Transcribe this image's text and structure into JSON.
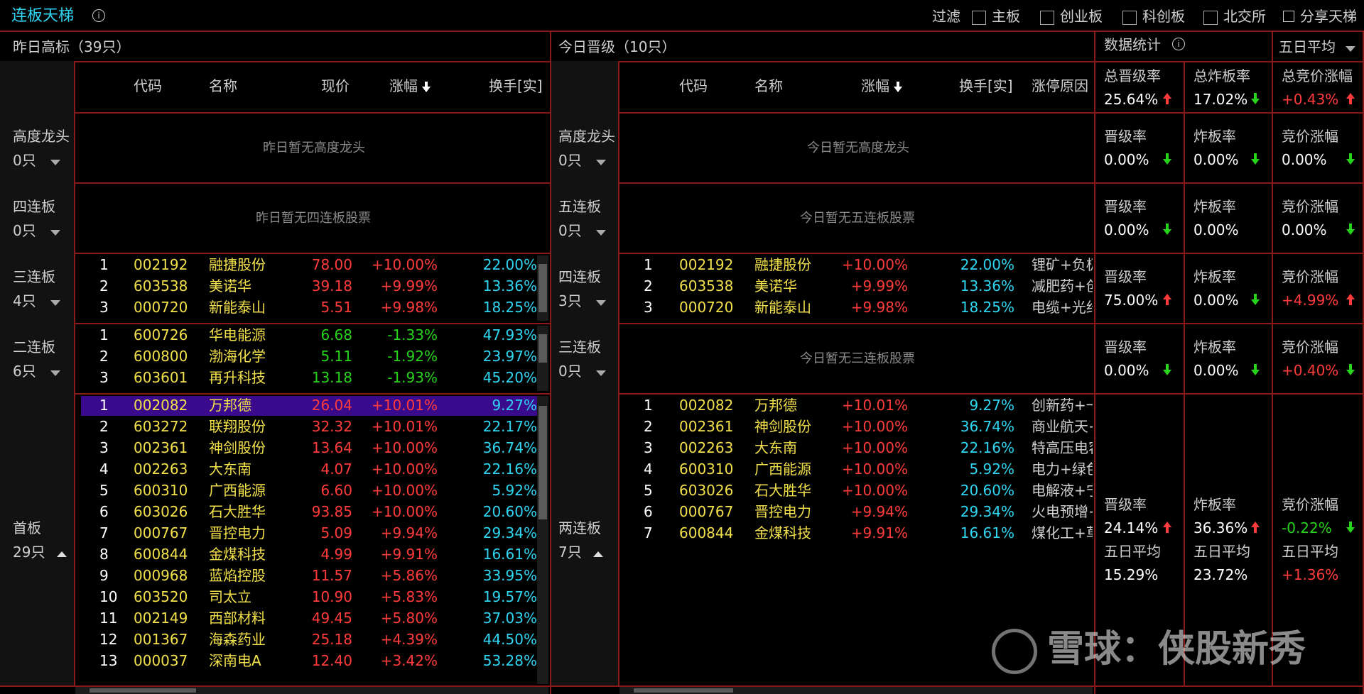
{
  "header": {
    "title": "连板天梯",
    "filter_label": "过滤",
    "filters": [
      "主板",
      "创业板",
      "科创板",
      "北交所"
    ],
    "share_label": "分享天梯"
  },
  "left": {
    "title": "昨日高标（39只）",
    "columns": [
      "代码",
      "名称",
      "现价",
      "涨幅",
      "换手[实]"
    ],
    "groups": [
      {
        "label": "高度龙头",
        "count": "0只",
        "empty": "昨日暂无高度龙头"
      },
      {
        "label": "四连板",
        "count": "0只",
        "empty": "昨日暂无四连板股票"
      },
      {
        "label": "三连板",
        "count": "4只"
      },
      {
        "label": "二连板",
        "count": "6只"
      },
      {
        "label": "首板",
        "count": "29只"
      }
    ],
    "rows_3": [
      [
        "1",
        "002192",
        "融捷股份",
        "78.00",
        "+10.00%",
        "22.00%"
      ],
      [
        "2",
        "603538",
        "美诺华",
        "39.18",
        "+9.99%",
        "13.36%"
      ],
      [
        "3",
        "000720",
        "新能泰山",
        "5.51",
        "+9.98%",
        "18.25%"
      ]
    ],
    "rows_2": [
      [
        "1",
        "600726",
        "华电能源",
        "6.68",
        "-1.33%",
        "47.93%"
      ],
      [
        "2",
        "600800",
        "渤海化学",
        "5.11",
        "-1.92%",
        "23.97%"
      ],
      [
        "3",
        "603601",
        "再升科技",
        "13.18",
        "-1.93%",
        "45.20%"
      ]
    ],
    "rows_1": [
      [
        "1",
        "002082",
        "万邦德",
        "26.04",
        "+10.01%",
        "9.27%"
      ],
      [
        "2",
        "603272",
        "联翔股份",
        "32.32",
        "+10.01%",
        "22.17%"
      ],
      [
        "3",
        "002361",
        "神剑股份",
        "13.64",
        "+10.00%",
        "36.74%"
      ],
      [
        "4",
        "002263",
        "大东南",
        "4.07",
        "+10.00%",
        "22.16%"
      ],
      [
        "5",
        "600310",
        "广西能源",
        "6.60",
        "+10.00%",
        "5.92%"
      ],
      [
        "6",
        "603026",
        "石大胜华",
        "93.85",
        "+10.00%",
        "20.60%"
      ],
      [
        "7",
        "000767",
        "晋控电力",
        "5.09",
        "+9.94%",
        "29.34%"
      ],
      [
        "8",
        "600844",
        "金煤科技",
        "4.99",
        "+9.91%",
        "16.61%"
      ],
      [
        "9",
        "000968",
        "蓝焰控股",
        "11.57",
        "+5.86%",
        "33.95%"
      ],
      [
        "10",
        "603520",
        "司太立",
        "10.90",
        "+5.83%",
        "19.57%"
      ],
      [
        "11",
        "002149",
        "西部材料",
        "49.45",
        "+5.80%",
        "37.03%"
      ],
      [
        "12",
        "001367",
        "海森药业",
        "25.18",
        "+4.39%",
        "44.50%"
      ],
      [
        "13",
        "000037",
        "深南电A",
        "12.40",
        "+3.42%",
        "53.28%"
      ]
    ]
  },
  "middle": {
    "title": "今日晋级（10只）",
    "columns": [
      "代码",
      "名称",
      "涨幅",
      "换手[实]",
      "涨停原因"
    ],
    "groups": [
      {
        "label": "高度龙头",
        "count": "0只",
        "empty": "今日暂无高度龙头"
      },
      {
        "label": "五连板",
        "count": "0只",
        "empty": "今日暂无五连板股票"
      },
      {
        "label": "四连板",
        "count": "3只"
      },
      {
        "label": "三连板",
        "count": "0只",
        "empty": "今日暂无三连板股票"
      },
      {
        "label": "两连板",
        "count": "7只"
      }
    ],
    "rows_4": [
      [
        "1",
        "002192",
        "融捷股份",
        "+10.00%",
        "22.00%",
        "锂矿+负极"
      ],
      [
        "2",
        "603538",
        "美诺华",
        "+9.99%",
        "13.36%",
        "减肥药+创"
      ],
      [
        "3",
        "000720",
        "新能泰山",
        "+9.98%",
        "18.25%",
        "电缆+光纤"
      ]
    ],
    "rows_2": [
      [
        "1",
        "002082",
        "万邦德",
        "+10.01%",
        "9.27%",
        "创新药+一"
      ],
      [
        "2",
        "002361",
        "神剑股份",
        "+10.00%",
        "36.74%",
        "商业航天+"
      ],
      [
        "3",
        "002263",
        "大东南",
        "+10.00%",
        "22.16%",
        "特高压电容"
      ],
      [
        "4",
        "600310",
        "广西能源",
        "+10.00%",
        "5.92%",
        "电力+绿色"
      ],
      [
        "5",
        "603026",
        "石大胜华",
        "+10.00%",
        "20.60%",
        "电解液+宁"
      ],
      [
        "6",
        "000767",
        "晋控电力",
        "+9.94%",
        "29.34%",
        "火电预增+"
      ],
      [
        "7",
        "600844",
        "金煤科技",
        "+9.91%",
        "16.61%",
        "煤化工+草"
      ]
    ]
  },
  "stats": {
    "title": "数据统计",
    "period": "五日平均",
    "totals": [
      {
        "label": "总晋级率",
        "value": "25.64%",
        "dir": "up",
        "color": "white"
      },
      {
        "label": "总炸板率",
        "value": "17.02%",
        "dir": "down",
        "color": "white"
      },
      {
        "label": "总竞价涨幅",
        "value": "+0.43%",
        "dir": "up",
        "color": "red"
      }
    ],
    "rows": [
      [
        {
          "label": "晋级率",
          "value": "0.00%",
          "dir": "down",
          "color": "white"
        },
        {
          "label": "炸板率",
          "value": "0.00%",
          "dir": "down",
          "color": "white"
        },
        {
          "label": "竞价涨幅",
          "value": "0.00%",
          "dir": "down",
          "color": "white"
        }
      ],
      [
        {
          "label": "晋级率",
          "value": "0.00%",
          "dir": "down",
          "color": "white"
        },
        {
          "label": "炸板率",
          "value": "0.00%",
          "dir": "",
          "color": "white"
        },
        {
          "label": "竞价涨幅",
          "value": "0.00%",
          "dir": "down",
          "color": "white"
        }
      ],
      [
        {
          "label": "晋级率",
          "value": "75.00%",
          "dir": "up",
          "color": "white"
        },
        {
          "label": "炸板率",
          "value": "0.00%",
          "dir": "down",
          "color": "white"
        },
        {
          "label": "竞价涨幅",
          "value": "+4.99%",
          "dir": "up",
          "color": "red"
        }
      ],
      [
        {
          "label": "晋级率",
          "value": "0.00%",
          "dir": "down",
          "color": "white"
        },
        {
          "label": "炸板率",
          "value": "0.00%",
          "dir": "down",
          "color": "white"
        },
        {
          "label": "竞价涨幅",
          "value": "+0.40%",
          "dir": "down",
          "color": "red"
        }
      ]
    ],
    "last": [
      {
        "label": "晋级率",
        "value": "24.14%",
        "dir": "up",
        "color": "white",
        "avg_label": "五日平均",
        "avg": "15.29%",
        "avg_color": "white"
      },
      {
        "label": "炸板率",
        "value": "36.36%",
        "dir": "up",
        "color": "white",
        "avg_label": "五日平均",
        "avg": "23.72%",
        "avg_color": "white"
      },
      {
        "label": "竞价涨幅",
        "value": "-0.22%",
        "dir": "down",
        "color": "green",
        "avg_label": "五日平均",
        "avg": "+1.36%",
        "avg_color": "red"
      }
    ]
  },
  "watermark": "雪球：侠股新秀"
}
